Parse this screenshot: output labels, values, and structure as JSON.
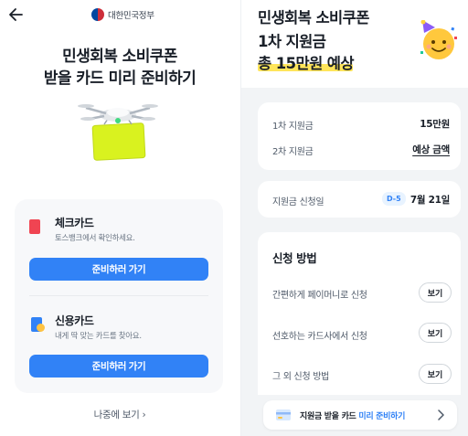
{
  "colors": {
    "primary": "#3182f6",
    "highlight": "#ffe55a",
    "check_card": "#f04452",
    "credit_card": "#3182f6"
  },
  "left": {
    "back_icon": "arrow-left-icon",
    "gov_label": "대한민국정부",
    "title_line1": "민생회복 소비쿠폰",
    "title_line2": "받을 카드 미리 준비하기",
    "cards": [
      {
        "name": "체크카드",
        "sub": "토스뱅크에서 확인하세요.",
        "button": "준비하러 가기"
      },
      {
        "name": "신용카드",
        "sub": "내게 딱 맞는 카드를 찾아요.",
        "button": "준비하러 가기"
      }
    ],
    "later": "나중에 보기",
    "later_icon": "chevron-right-icon"
  },
  "right": {
    "title_line1": "민생회복 소비쿠폰",
    "title_line2": "1차 지원금",
    "title_line3": "총 15만원 예상",
    "amounts": [
      {
        "label": "1차 지원금",
        "value": "15만원"
      },
      {
        "label": "2차 지원금",
        "value": "예상 금액"
      }
    ],
    "apply_date": {
      "label": "지원금 신청일",
      "badge": "D-5",
      "value": "7월 21일"
    },
    "methods": {
      "title": "신청 방법",
      "items": [
        {
          "label": "간편하게 페이머니로 신청",
          "button": "보기"
        },
        {
          "label": "선호하는 카드사에서 신청",
          "button": "보기"
        },
        {
          "label": "그 외 신청 방법",
          "button": "보기"
        }
      ]
    },
    "prep_banner": {
      "text": "지원금 받을 카드 ",
      "highlight": "미리 준비하기",
      "icon": "card-icon"
    }
  }
}
